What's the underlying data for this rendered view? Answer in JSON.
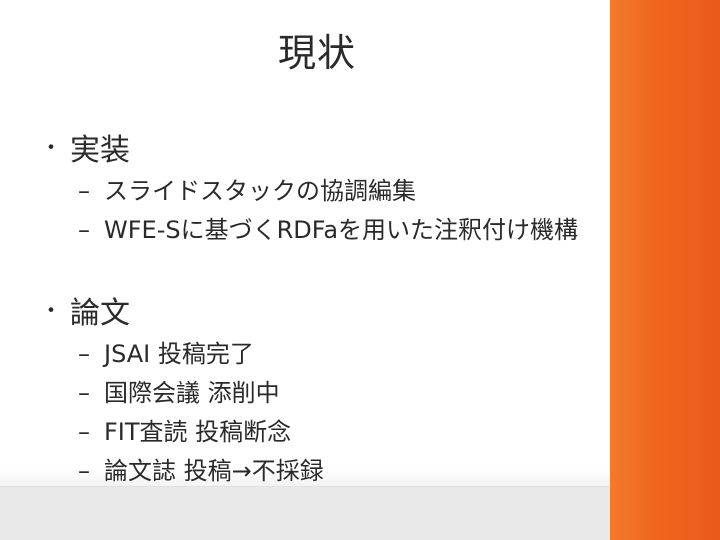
{
  "slide": {
    "title": "現状",
    "sections": [
      {
        "bullet": "・",
        "heading": "実装",
        "items": [
          "スライドスタックの協調編集",
          "WFE-Sに基づくRDFaを用いた注釈付け機構"
        ]
      },
      {
        "bullet": "・",
        "heading": "論文",
        "items": [
          "JSAI 投稿完了",
          "国際会議 添削中",
          "FIT査読 投稿断念",
          "論文誌 投稿→不採録"
        ]
      }
    ],
    "dash": "–"
  },
  "colors": {
    "accent": "#f0661f",
    "text": "#2a2a2a",
    "background": "#ffffff"
  }
}
